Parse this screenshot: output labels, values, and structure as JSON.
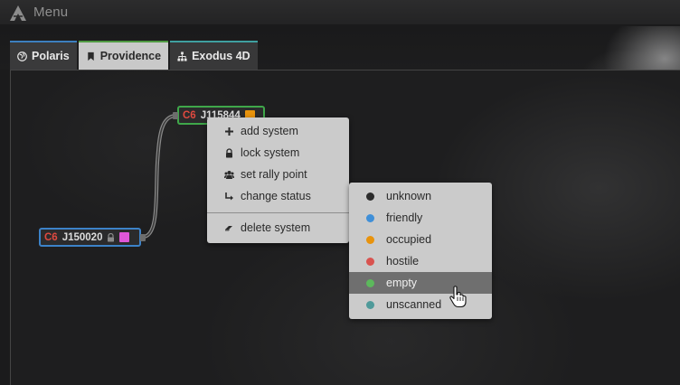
{
  "menubar": {
    "logo_icon": "logo-icon",
    "title": "Menu"
  },
  "tabs": [
    {
      "label": "Polaris",
      "icon": "globe-icon",
      "accent": "#3d7fbf",
      "active": false
    },
    {
      "label": "Providence",
      "icon": "bookmark-icon",
      "accent": "#4f9a42",
      "active": true
    },
    {
      "label": "Exodus 4D",
      "icon": "sitemap-icon",
      "accent": "#3fa0a0",
      "active": false
    }
  ],
  "systems": [
    {
      "class": "C6",
      "name": "J150020",
      "locked": true,
      "status_color": "#e056d8",
      "border": "#3c82c8"
    },
    {
      "class": "C6",
      "name": "J115844",
      "locked": false,
      "status_color": "#e8930c",
      "border": "#3fa74a"
    }
  ],
  "context_menu": {
    "items": [
      {
        "label": "add system",
        "icon": "plus-icon"
      },
      {
        "label": "lock system",
        "icon": "lock-icon"
      },
      {
        "label": "set rally point",
        "icon": "users-icon"
      },
      {
        "label": "change status",
        "icon": "share-arrow-icon"
      },
      {
        "label": "delete system",
        "icon": "eraser-icon"
      }
    ]
  },
  "status_menu": {
    "items": [
      {
        "label": "unknown",
        "color": "#2c2c2c"
      },
      {
        "label": "friendly",
        "color": "#3f8fd8"
      },
      {
        "label": "occupied",
        "color": "#e8930c"
      },
      {
        "label": "hostile",
        "color": "#d9534f"
      },
      {
        "label": "empty",
        "color": "#5cb85c",
        "hovered": true
      },
      {
        "label": "unscanned",
        "color": "#4f9a9a"
      }
    ]
  }
}
